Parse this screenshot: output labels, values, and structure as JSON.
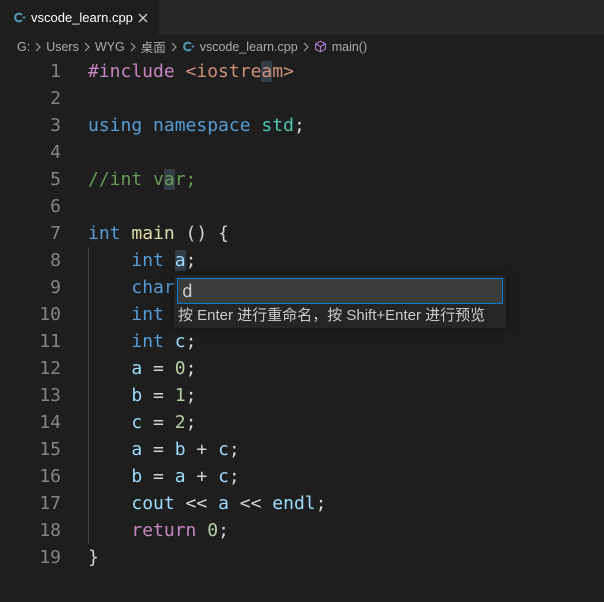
{
  "tab": {
    "label": "vscode_learn.cpp",
    "icon": "cpp-file-icon",
    "close_icon": "close-icon"
  },
  "breadcrumb": {
    "items": [
      {
        "label": "G:"
      },
      {
        "label": "Users"
      },
      {
        "label": "WYG"
      },
      {
        "label": "桌面"
      },
      {
        "label": "vscode_learn.cpp",
        "icon": "cpp-file-icon"
      },
      {
        "label": "main()",
        "icon": "method-symbol-icon"
      }
    ]
  },
  "editor": {
    "lines": [
      {
        "number": 1,
        "tokens": [
          {
            "text": "#include",
            "color": "#c586c0"
          },
          {
            "text": " "
          },
          {
            "text": "<iostre",
            "color": "#ce9178"
          },
          {
            "text": "a",
            "color": "#ce9178",
            "highlight": true
          },
          {
            "text": "m>",
            "color": "#ce9178"
          }
        ]
      },
      {
        "number": 2,
        "tokens": []
      },
      {
        "number": 3,
        "tokens": [
          {
            "text": "using",
            "color": "#569cd6"
          },
          {
            "text": " "
          },
          {
            "text": "namespace",
            "color": "#569cd6"
          },
          {
            "text": " "
          },
          {
            "text": "std",
            "color": "#4ec9b0"
          },
          {
            "text": ";"
          }
        ]
      },
      {
        "number": 4,
        "tokens": []
      },
      {
        "number": 5,
        "tokens": [
          {
            "text": "//int v",
            "color": "#6a9955"
          },
          {
            "text": "a",
            "color": "#6a9955",
            "highlight": true
          },
          {
            "text": "r;",
            "color": "#6a9955"
          }
        ]
      },
      {
        "number": 6,
        "tokens": []
      },
      {
        "number": 7,
        "tokens": [
          {
            "text": "int",
            "color": "#569cd6"
          },
          {
            "text": " "
          },
          {
            "text": "main",
            "color": "#dcdcaa"
          },
          {
            "text": " () {"
          }
        ]
      },
      {
        "number": 8,
        "tokens": [
          {
            "text": "    "
          },
          {
            "text": "int",
            "color": "#569cd6"
          },
          {
            "text": " "
          },
          {
            "text": "a",
            "color": "#9cdcfe",
            "highlight": true
          },
          {
            "text": ";"
          }
        ]
      },
      {
        "number": 9,
        "tokens": [
          {
            "text": "    "
          },
          {
            "text": "char",
            "color": "#569cd6"
          }
        ]
      },
      {
        "number": 10,
        "tokens": [
          {
            "text": "    "
          },
          {
            "text": "int",
            "color": "#569cd6"
          }
        ]
      },
      {
        "number": 11,
        "tokens": [
          {
            "text": "    "
          },
          {
            "text": "int",
            "color": "#569cd6"
          },
          {
            "text": " "
          },
          {
            "text": "c",
            "color": "#9cdcfe"
          },
          {
            "text": ";"
          }
        ]
      },
      {
        "number": 12,
        "tokens": [
          {
            "text": "    "
          },
          {
            "text": "a",
            "color": "#9cdcfe"
          },
          {
            "text": " = "
          },
          {
            "text": "0",
            "color": "#b5cea8"
          },
          {
            "text": ";"
          }
        ]
      },
      {
        "number": 13,
        "tokens": [
          {
            "text": "    "
          },
          {
            "text": "b",
            "color": "#9cdcfe"
          },
          {
            "text": " = "
          },
          {
            "text": "1",
            "color": "#b5cea8"
          },
          {
            "text": ";"
          }
        ]
      },
      {
        "number": 14,
        "tokens": [
          {
            "text": "    "
          },
          {
            "text": "c",
            "color": "#9cdcfe"
          },
          {
            "text": " = "
          },
          {
            "text": "2",
            "color": "#b5cea8"
          },
          {
            "text": ";"
          }
        ]
      },
      {
        "number": 15,
        "tokens": [
          {
            "text": "    "
          },
          {
            "text": "a",
            "color": "#9cdcfe"
          },
          {
            "text": " = "
          },
          {
            "text": "b",
            "color": "#9cdcfe"
          },
          {
            "text": " + "
          },
          {
            "text": "c",
            "color": "#9cdcfe"
          },
          {
            "text": ";"
          }
        ]
      },
      {
        "number": 16,
        "tokens": [
          {
            "text": "    "
          },
          {
            "text": "b",
            "color": "#9cdcfe"
          },
          {
            "text": " = "
          },
          {
            "text": "a",
            "color": "#9cdcfe"
          },
          {
            "text": " + "
          },
          {
            "text": "c",
            "color": "#9cdcfe"
          },
          {
            "text": ";"
          }
        ]
      },
      {
        "number": 17,
        "tokens": [
          {
            "text": "    "
          },
          {
            "text": "cout",
            "color": "#9cdcfe"
          },
          {
            "text": " << "
          },
          {
            "text": "a",
            "color": "#9cdcfe"
          },
          {
            "text": " << "
          },
          {
            "text": "endl",
            "color": "#9cdcfe"
          },
          {
            "text": ";"
          }
        ]
      },
      {
        "number": 18,
        "tokens": [
          {
            "text": "    "
          },
          {
            "text": "return",
            "color": "#c586c0"
          },
          {
            "text": " "
          },
          {
            "text": "0",
            "color": "#b5cea8"
          },
          {
            "text": ";"
          }
        ]
      },
      {
        "number": 19,
        "tokens": [
          {
            "text": "}"
          }
        ]
      }
    ]
  },
  "rename_widget": {
    "value": "d",
    "hint": "按 Enter 进行重命名，按 Shift+Enter 进行预览"
  },
  "colors": {
    "text": "#d4d4d4",
    "line_number": "#858585",
    "word_highlight": "#343e47"
  }
}
